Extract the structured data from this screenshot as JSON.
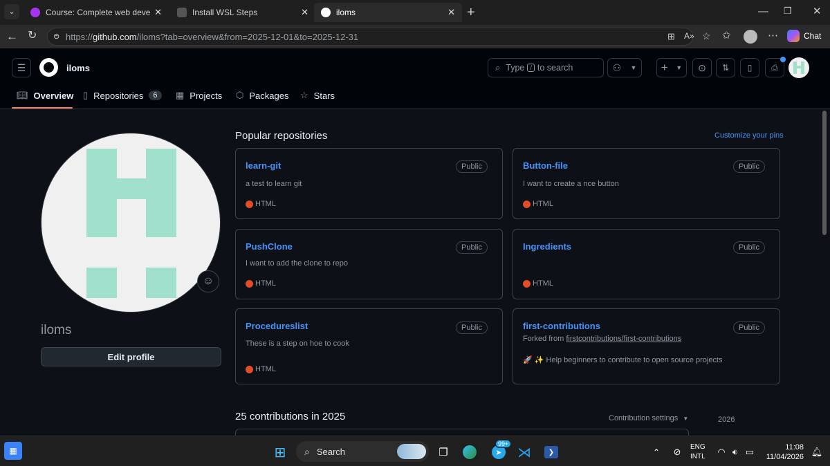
{
  "browser": {
    "tabs": [
      {
        "title": "Course: Complete web developme",
        "active": false
      },
      {
        "title": "Install WSL Steps",
        "active": false
      },
      {
        "title": "iloms",
        "active": true
      }
    ],
    "url_prefix": "https://",
    "url_host": "github.com",
    "url_path": "/iloms?tab=overview&from=2025-12-01&to=2025-12-31",
    "chat_label": "Chat"
  },
  "github": {
    "username": "iloms",
    "search_prefix": "Type",
    "search_key": "/",
    "search_suffix": "to search",
    "nav": [
      {
        "label": "Overview",
        "icon": "book-icon",
        "active": true
      },
      {
        "label": "Repositories",
        "icon": "repo-icon",
        "count": "6"
      },
      {
        "label": "Projects",
        "icon": "table-icon"
      },
      {
        "label": "Packages",
        "icon": "package-icon"
      },
      {
        "label": "Stars",
        "icon": "star-icon"
      }
    ]
  },
  "profile": {
    "display_name": "iloms",
    "edit_button": "Edit profile",
    "avatar_color": "#a0e0cc"
  },
  "pinned": {
    "heading": "Popular repositories",
    "customize_link": "Customize your pins",
    "repos": [
      {
        "name": "learn-git",
        "visibility": "Public",
        "description": "a test to learn git",
        "language": "HTML"
      },
      {
        "name": "Button-file",
        "visibility": "Public",
        "description": "I want to create a nce button",
        "language": "HTML"
      },
      {
        "name": "PushClone",
        "visibility": "Public",
        "description": "I want to add the clone to repo",
        "language": "HTML"
      },
      {
        "name": "Ingredients",
        "visibility": "Public",
        "description": "",
        "language": "HTML"
      },
      {
        "name": "Procedureslist",
        "visibility": "Public",
        "description": "These is a step on hoe to cook",
        "language": "HTML"
      },
      {
        "name": "first-contributions",
        "visibility": "Public",
        "forked_prefix": "Forked from",
        "forked_from": "firstcontributions/first-contributions",
        "description": "🚀 ✨ Help beginners to contribute to open source projects"
      }
    ]
  },
  "contributions": {
    "heading": "25 contributions in 2025",
    "settings_label": "Contribution settings",
    "year": "2026"
  },
  "taskbar": {
    "search_label": "Search",
    "badge": "99+",
    "lang_top": "ENG",
    "lang_bottom": "INTL",
    "time": "11:08",
    "date": "11/04/2026"
  },
  "colors": {
    "link": "#4493f8",
    "html_language": "#e34c26",
    "active_tab_underline": "#f78166"
  }
}
